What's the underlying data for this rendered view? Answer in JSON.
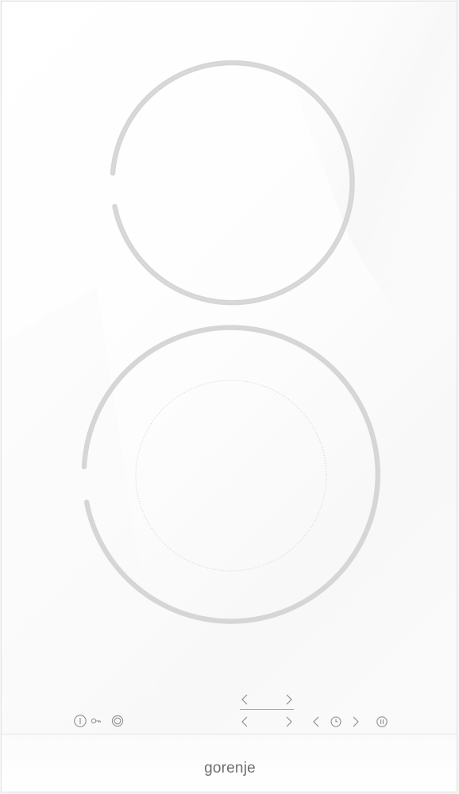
{
  "product": {
    "brand_name": "gorenje"
  },
  "cooking_zones": [
    {
      "name": "rear-zone",
      "type": "single"
    },
    {
      "name": "front-zone",
      "type": "dual"
    }
  ],
  "controls": {
    "power": {
      "icon": "power-icon"
    },
    "lock": {
      "icon": "key-lock-icon"
    },
    "dual_zone": {
      "icon": "dual-zone-icon"
    },
    "rear_zone_minus": {
      "icon": "chevron-left-icon"
    },
    "rear_zone_plus": {
      "icon": "chevron-right-icon"
    },
    "front_zone_minus": {
      "icon": "chevron-left-icon"
    },
    "front_zone_plus": {
      "icon": "chevron-right-icon"
    },
    "timer_minus": {
      "icon": "chevron-left-icon"
    },
    "timer": {
      "icon": "clock-icon"
    },
    "timer_plus": {
      "icon": "chevron-right-icon"
    },
    "pause": {
      "icon": "pause-icon"
    }
  },
  "colors": {
    "glass": "#ffffff",
    "print": "#9a9a9a",
    "zone_dots": "#d2d2d2",
    "brand": "#6e6e6e"
  }
}
